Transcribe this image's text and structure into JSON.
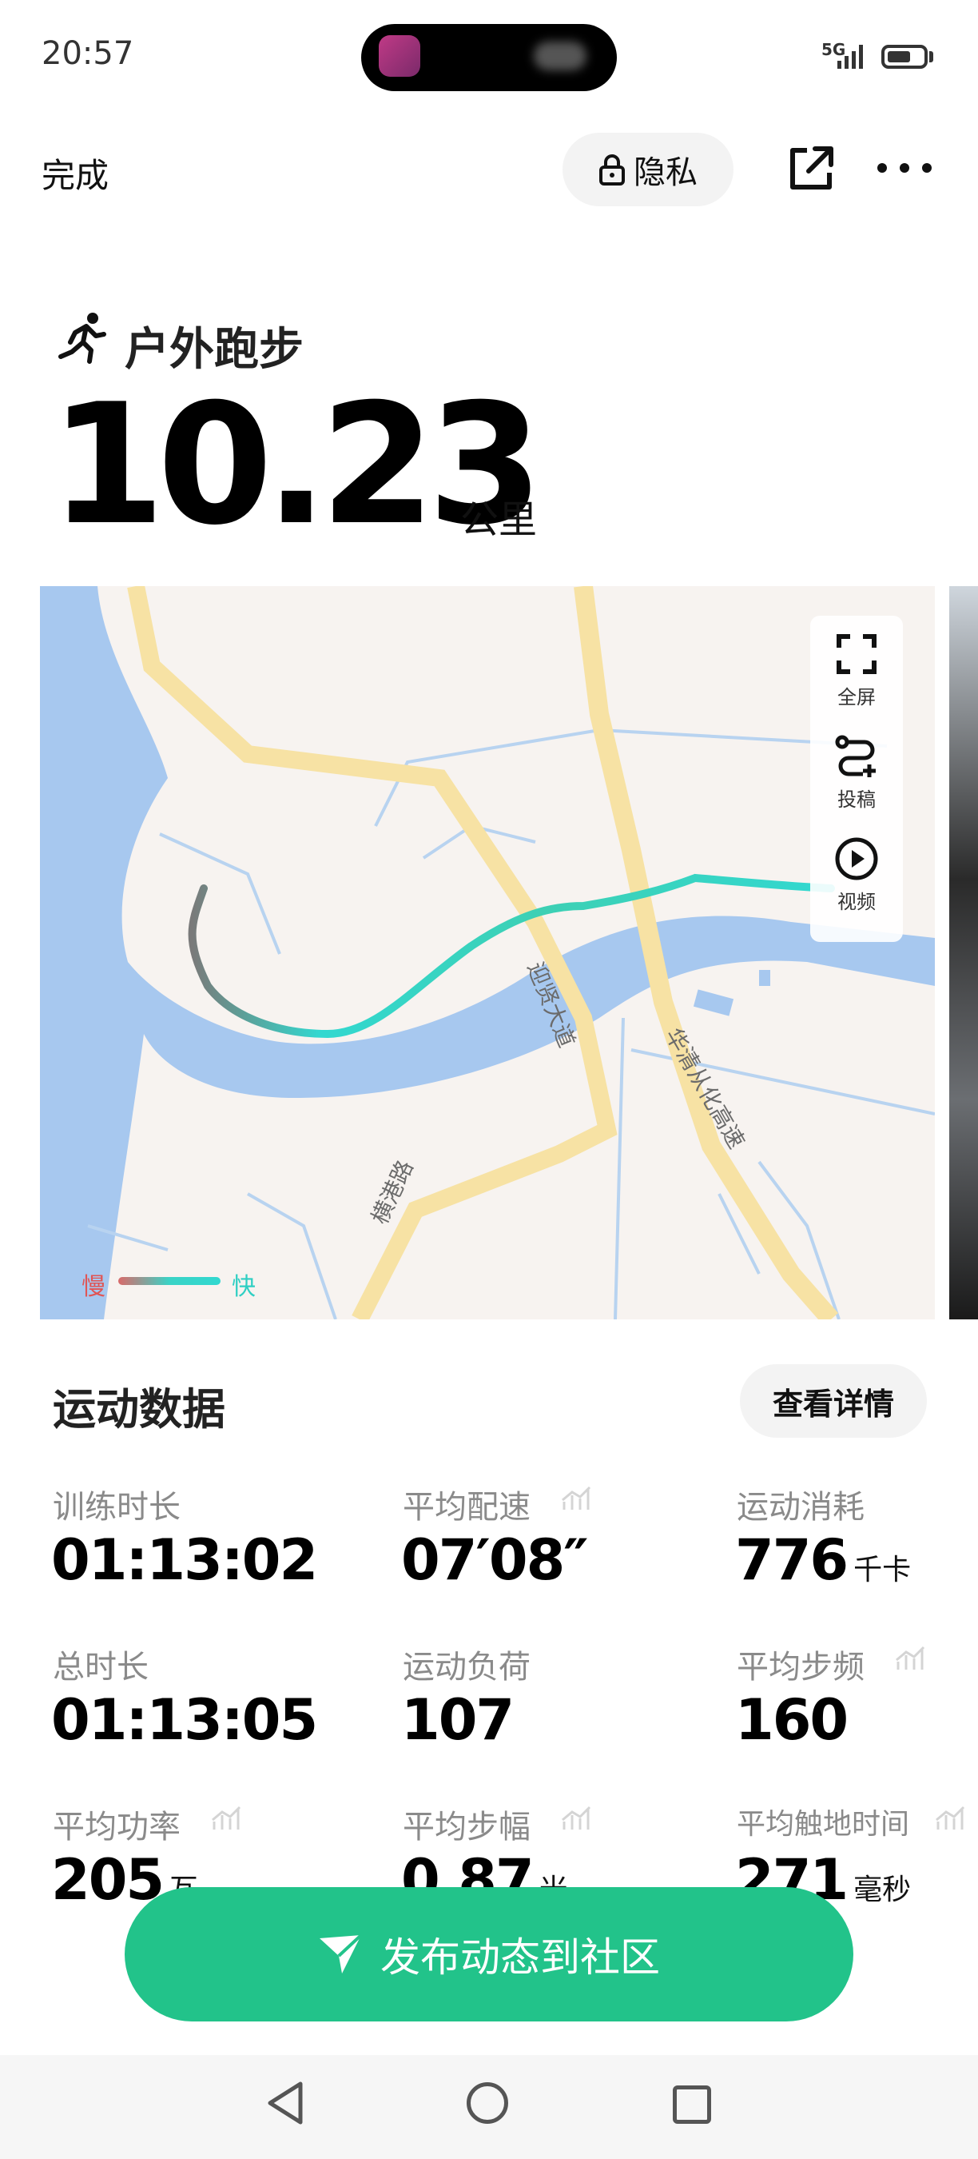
{
  "status_bar": {
    "time": "20:57",
    "network": "5G"
  },
  "header": {
    "done": "完成",
    "privacy": "隐私"
  },
  "activity": {
    "type": "户外跑步",
    "distance": "10.23",
    "unit": "公里"
  },
  "map": {
    "controls": {
      "fullscreen": "全屏",
      "submit": "投稿",
      "video": "视频"
    },
    "roads": [
      "迎贤大道",
      "华清从化高速",
      "横港路"
    ],
    "legend": {
      "slow": "慢",
      "fast": "快"
    }
  },
  "data_section": {
    "title": "运动数据",
    "details_button": "查看详情",
    "stats": [
      {
        "label": "训练时长",
        "value": "01:13:02",
        "unit": ""
      },
      {
        "label": "平均配速",
        "value": "07′08″",
        "unit": ""
      },
      {
        "label": "运动消耗",
        "value": "776",
        "unit": "千卡"
      },
      {
        "label": "总时长",
        "value": "01:13:05",
        "unit": ""
      },
      {
        "label": "运动负荷",
        "value": "107",
        "unit": ""
      },
      {
        "label": "平均步频",
        "value": "160",
        "unit": ""
      },
      {
        "label": "平均功率",
        "value": "205",
        "unit": "瓦"
      },
      {
        "label": "平均步幅",
        "value": "0.87",
        "unit": "米"
      },
      {
        "label": "平均触地时间",
        "value": "271",
        "unit": "毫秒"
      }
    ]
  },
  "publish_button": "发布动态到社区",
  "colors": {
    "accent": "#22c38a",
    "route_fast": "#32d8d0",
    "route_slow": "#d96a6a"
  }
}
